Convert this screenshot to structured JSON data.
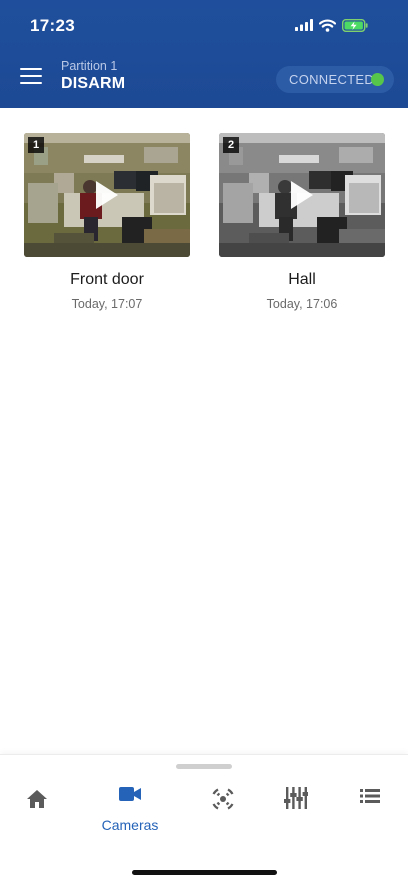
{
  "status_bar": {
    "time": "17:23"
  },
  "header": {
    "partition_label": "Partition 1",
    "mode": "DISARM",
    "connection_status": "CONNECTED",
    "connection_color": "#56c64a"
  },
  "cameras": [
    {
      "number": "1",
      "name": "Front door",
      "last_event": "Today, 17:07",
      "feed": "color"
    },
    {
      "number": "2",
      "name": "Hall",
      "last_event": "Today, 17:06",
      "feed": "grayscale"
    }
  ],
  "tabbar": {
    "active": "cameras",
    "items": [
      {
        "id": "home",
        "icon": "home-icon",
        "label": ""
      },
      {
        "id": "cameras",
        "icon": "video-camera-icon",
        "label": "Cameras"
      },
      {
        "id": "sensors",
        "icon": "sensor-icon",
        "label": ""
      },
      {
        "id": "controls",
        "icon": "sliders-icon",
        "label": ""
      },
      {
        "id": "events",
        "icon": "list-icon",
        "label": ""
      }
    ],
    "active_color": "#2563b8",
    "inactive_color": "#5b5b5b"
  }
}
